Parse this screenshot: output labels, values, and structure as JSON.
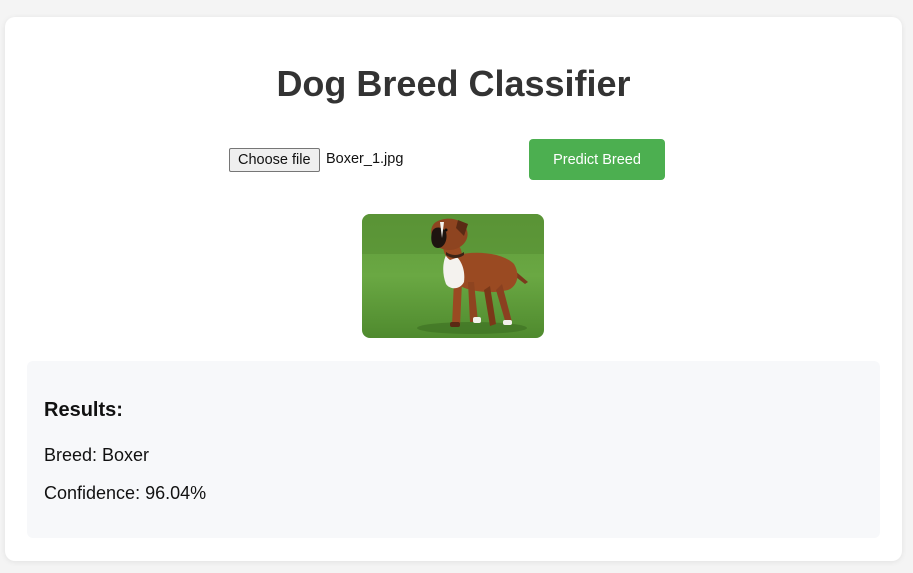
{
  "app": {
    "title": "Dog Breed Classifier"
  },
  "upload": {
    "choose_label": "Choose file",
    "file_name": "Boxer_1.jpg",
    "predict_label": "Predict Breed",
    "accent_color": "#4caf50"
  },
  "results": {
    "heading": "Results:",
    "breed_text": "Breed: Boxer",
    "confidence_text": "Confidence: 96.04%"
  }
}
